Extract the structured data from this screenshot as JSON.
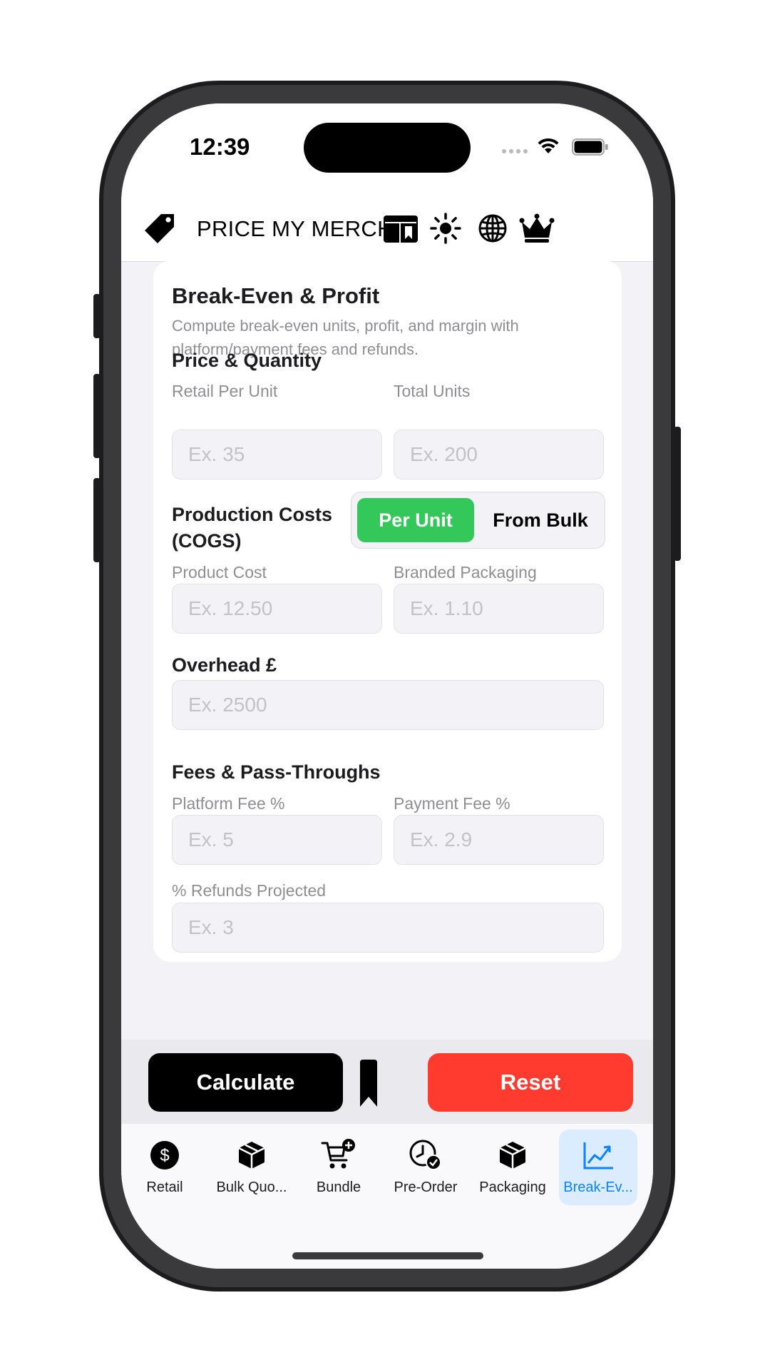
{
  "status_bar": {
    "time": "12:39"
  },
  "header": {
    "title": "PRICE MY MERCH",
    "icons": [
      "price-tag-icon",
      "saved-layout-icon",
      "brightness-icon",
      "globe-icon",
      "crown-icon"
    ]
  },
  "card": {
    "title": "Break-Even & Profit",
    "subtitle": "Compute break-even units, profit, and margin with platform/payment fees and refunds.",
    "price_qty": {
      "title": "Price & Quantity",
      "retail_label": "Retail Per Unit",
      "retail_placeholder": "Ex. 35",
      "units_label": "Total Units",
      "units_placeholder": "Ex. 200"
    },
    "cogs": {
      "title_line1": "Production Costs",
      "title_line2": "(COGS)",
      "mode_selected": "Per Unit",
      "mode_other": "From Bulk",
      "product_cost_label": "Product Cost",
      "product_cost_placeholder": "Ex. 12.50",
      "packaging_label": "Branded Packaging",
      "packaging_placeholder": "Ex. 1.10"
    },
    "overhead": {
      "title": "Overhead £",
      "placeholder": "Ex. 2500"
    },
    "fees": {
      "title": "Fees & Pass-Throughs",
      "platform_label": "Platform Fee %",
      "platform_placeholder": "Ex. 5",
      "payment_label": "Payment Fee %",
      "payment_placeholder": "Ex. 2.9",
      "refunds_label": "% Refunds Projected",
      "refunds_placeholder": "Ex. 3"
    }
  },
  "actions": {
    "calculate": "Calculate",
    "reset": "Reset"
  },
  "tabs": [
    {
      "label": "Retail",
      "icon": "dollar-icon"
    },
    {
      "label": "Bulk Quo...",
      "icon": "box-icon"
    },
    {
      "label": "Bundle",
      "icon": "cart-add-icon"
    },
    {
      "label": "Pre-Order",
      "icon": "clock-check-icon"
    },
    {
      "label": "Packaging",
      "icon": "box-icon"
    },
    {
      "label": "Break-Ev...",
      "icon": "trend-chart-icon",
      "active": true
    }
  ],
  "colors": {
    "accent_green": "#34c759",
    "reset_red": "#ff3b30",
    "active_tab_blue": "#0a84ff"
  }
}
